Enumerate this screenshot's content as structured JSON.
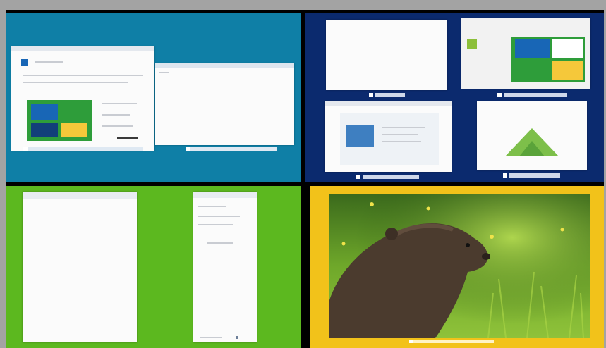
{
  "colors": {
    "q1_bg": "#0f7fa6",
    "q2_bg": "#0b2a6e",
    "q3_bg": "#5cb81f",
    "q4_bg": "#f2c21a",
    "tile_green": "#2e9d3a",
    "tile_yellow": "#f5c83a",
    "tile_blue": "#1866b6"
  },
  "quadrants": [
    {
      "id": "top-left",
      "style": "desktop with two overlapping windows"
    },
    {
      "id": "top-right",
      "style": "task view with four window thumbnails"
    },
    {
      "id": "bottom-left",
      "style": "two snapped windows"
    },
    {
      "id": "bottom-right",
      "style": "photo of a groundhog in grass"
    }
  ],
  "icons": {
    "thumbnail": "app-thumbnail-icon",
    "window": "window-icon",
    "photo": "photo-icon"
  }
}
